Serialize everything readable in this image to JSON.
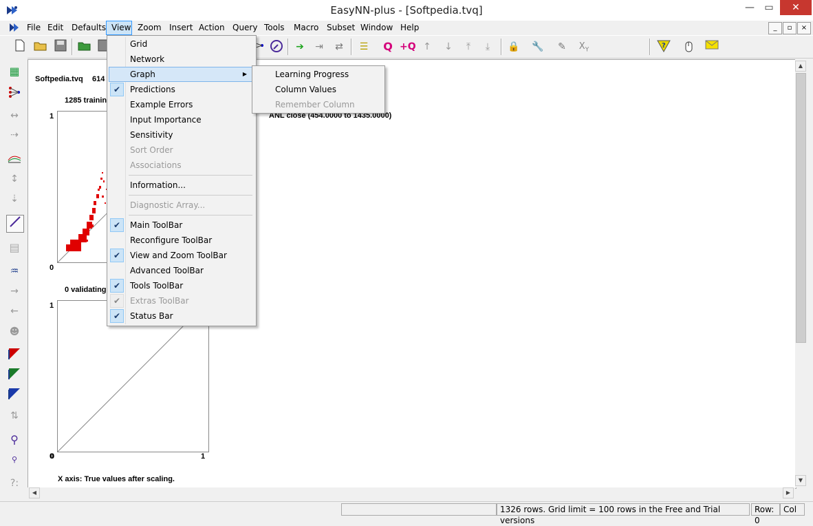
{
  "window": {
    "title": "EasyNN-plus - [Softpedia.tvq]",
    "minimize": "—",
    "maximize": "▭",
    "close": "✕"
  },
  "menubar": {
    "items": [
      "File",
      "Edit",
      "Defaults",
      "View",
      "Zoom",
      "Insert",
      "Action",
      "Query",
      "Tools",
      "Macro",
      "Subset",
      "Window",
      "Help"
    ],
    "active": "View",
    "mdi": [
      "_",
      "▫",
      "×"
    ]
  },
  "view_menu": {
    "items": [
      {
        "label": "Grid",
        "checked": false,
        "disabled": false
      },
      {
        "label": "Network",
        "checked": false,
        "disabled": false
      },
      {
        "label": "Graph",
        "checked": false,
        "disabled": false,
        "submenu": true,
        "highlighted": true
      },
      {
        "label": "Predictions",
        "checked": true,
        "disabled": false
      },
      {
        "label": "Example Errors",
        "checked": false,
        "disabled": false
      },
      {
        "label": "Input Importance",
        "checked": false,
        "disabled": false
      },
      {
        "label": "Sensitivity",
        "checked": false,
        "disabled": false
      },
      {
        "label": "Sort Order",
        "checked": false,
        "disabled": true
      },
      {
        "label": "Associations",
        "checked": false,
        "disabled": true
      },
      {
        "label": "Information...",
        "checked": false,
        "disabled": false
      },
      {
        "label": "Diagnostic Array...",
        "checked": false,
        "disabled": true
      },
      {
        "label": "Main ToolBar",
        "checked": true,
        "disabled": false
      },
      {
        "label": "Reconfigure ToolBar",
        "checked": false,
        "disabled": false
      },
      {
        "label": "View and Zoom ToolBar",
        "checked": true,
        "disabled": false
      },
      {
        "label": "Advanced ToolBar",
        "checked": false,
        "disabled": false
      },
      {
        "label": "Tools ToolBar",
        "checked": true,
        "disabled": false
      },
      {
        "label": "Extras ToolBar",
        "checked": true,
        "disabled": true
      },
      {
        "label": "Status Bar",
        "checked": true,
        "disabled": false
      }
    ]
  },
  "graph_submenu": {
    "items": [
      {
        "label": "Learning Progress",
        "disabled": false
      },
      {
        "label": "Column Values",
        "disabled": false
      },
      {
        "label": "Remember Column",
        "disabled": true
      }
    ]
  },
  "client": {
    "file_label": "Softpedia.tvq",
    "file_count": "614",
    "training_label": "1285 trainin",
    "column_range": "ANL close   (454.0000  to  1435.0000)",
    "validating_label": "0 validating",
    "plot1": {
      "y_top": "1",
      "y_bottom": "0"
    },
    "plot2": {
      "y_top": "1",
      "y_bottom": "0",
      "x_left": "0",
      "x_right": "1"
    },
    "x_axis_label": "X axis: True values after scaling."
  },
  "statusbar": {
    "message": "1326 rows. Grid limit = 100 rows in the Free and Trial versions",
    "row": "Row: 0",
    "col": "Col"
  },
  "icons": {
    "toolbar": [
      "new-icon",
      "open-icon",
      "save-icon",
      "open-grid-icon",
      "save-as-icon",
      "network-icon",
      "compass-icon",
      "arrow-right-icon",
      "forward-step-icon",
      "swap-icon",
      "sort-icon",
      "query-icon",
      "add-query-icon",
      "up-icon",
      "down-icon",
      "top-icon",
      "bottom-icon",
      "lock-icon",
      "wrench-icon",
      "pen-icon",
      "xy-icon",
      "filter-icon",
      "mouse-icon",
      "mail-icon"
    ],
    "left": [
      "grid-icon",
      "network-icon",
      "expand-icon",
      "contract-icon",
      "graph-icon",
      "vertical-expand-icon",
      "vertical-contract-icon",
      "predictions-icon",
      "table-icon",
      "sensitivity-icon",
      "right-arrow-icon",
      "left-arrow-icon",
      "head-icon",
      "red-triangle-icon",
      "green-triangle-icon",
      "blue-triangle-icon",
      "updown-icon",
      "zoom-icon",
      "small-zoom-icon",
      "help-icon"
    ]
  },
  "colors": {
    "scatter": "#ff0000",
    "menu_highlight": "#d5e7f8",
    "close_button": "#c7372f"
  }
}
